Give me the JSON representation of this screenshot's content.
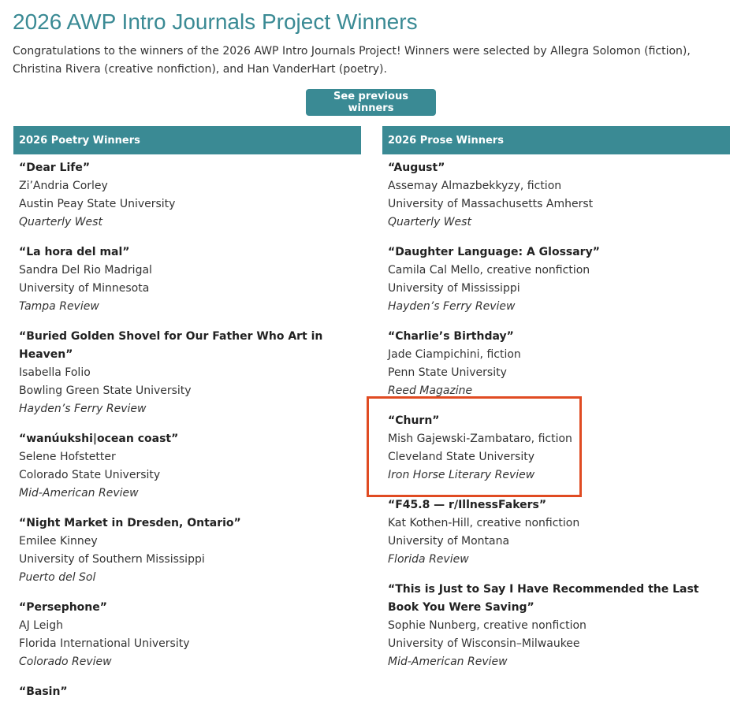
{
  "page": {
    "title": "2026 AWP Intro Journals Project Winners",
    "intro": "Congratulations to the winners of the 2026 AWP Intro Journals Project! Winners were selected by Allegra Solomon (fiction), Christina Rivera (creative nonfiction), and Han VanderHart (poetry).",
    "previous_button_label": "See previous winners"
  },
  "colors": {
    "accent": "#3a8a94",
    "highlight_border": "#e04b22"
  },
  "poetry": {
    "header": "2026 Poetry Winners",
    "entries": [
      {
        "title": "“Dear Life”",
        "author": "Zi’Andria Corley",
        "school": "Austin Peay State University",
        "journal": "Quarterly West"
      },
      {
        "title": "“La hora del mal”",
        "author": "Sandra Del Rio Madrigal",
        "school": "University of Minnesota",
        "journal": "Tampa Review"
      },
      {
        "title": "“Buried Golden Shovel for Our Father Who Art in Heaven”",
        "author": "Isabella Folio",
        "school": "Bowling Green State University",
        "journal": "Hayden’s Ferry Review"
      },
      {
        "title": "“wanúukshi|ocean coast”",
        "author": "Selene Hofstetter",
        "school": "Colorado State University",
        "journal": "Mid-American Review"
      },
      {
        "title": "“Night Market in Dresden, Ontario”",
        "author": "Emilee Kinney",
        "school": "University of Southern Mississippi",
        "journal": "Puerto del Sol"
      },
      {
        "title": "“Persephone”",
        "author": "AJ Leigh",
        "school": "Florida International University",
        "journal": "Colorado Review"
      },
      {
        "title": "“Basin”",
        "author": "",
        "school": "",
        "journal": ""
      }
    ]
  },
  "prose": {
    "header": "2026 Prose Winners",
    "entries": [
      {
        "title": "“August”",
        "author": "Assemay Almazbekkyzy, fiction",
        "school": "University of Massachusetts Amherst",
        "journal": "Quarterly West"
      },
      {
        "title": "“Daughter Language: A Glossary”",
        "author": "Camila Cal Mello, creative nonfiction",
        "school": "University of Mississippi",
        "journal": "Hayden’s Ferry Review"
      },
      {
        "title": "“Charlie’s Birthday”",
        "author": "Jade Ciampichini, fiction",
        "school": "Penn State University",
        "journal": "Reed Magazine"
      },
      {
        "title": "“Churn”",
        "author": "Mish Gajewski-Zambataro, fiction",
        "school": "Cleveland State University",
        "journal": "Iron Horse Literary Review"
      },
      {
        "title": "“F45.8 — r/IllnessFakers”",
        "author": "Kat Kothen-Hill, creative nonfiction",
        "school": "University of Montana",
        "journal": "Florida Review"
      },
      {
        "title": "“This is Just to Say I Have Recommended the Last Book You Were Saving”",
        "author": "Sophie Nunberg, creative nonfiction",
        "school": "University of Wisconsin–Milwaukee",
        "journal": "Mid-American Review"
      }
    ]
  }
}
